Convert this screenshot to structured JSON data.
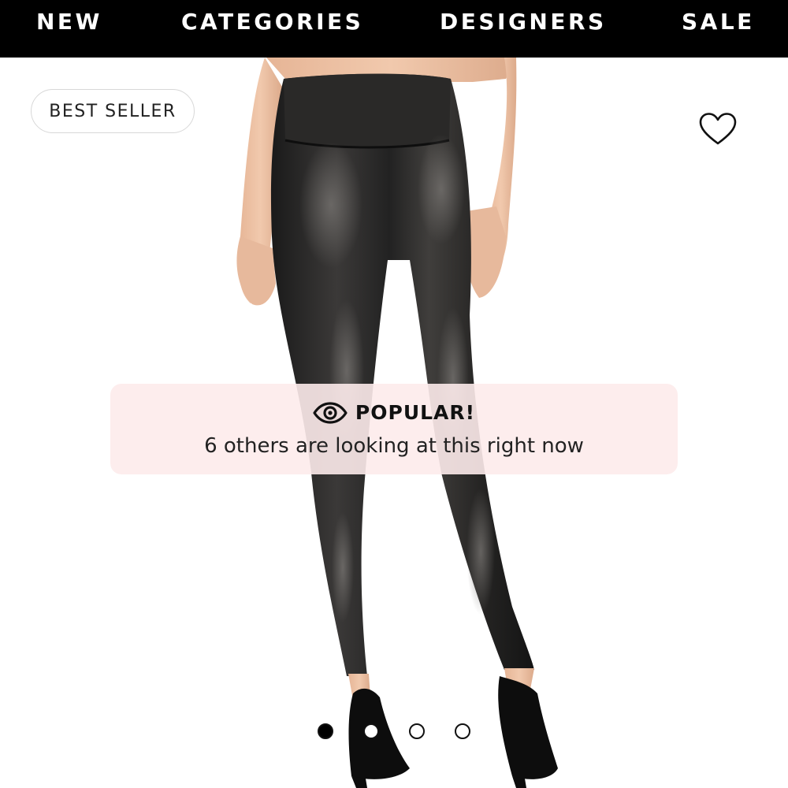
{
  "nav": {
    "items": [
      {
        "label": "NEW"
      },
      {
        "label": "CATEGORIES"
      },
      {
        "label": "DESIGNERS"
      },
      {
        "label": "SALE"
      }
    ]
  },
  "product": {
    "badge": "BEST SELLER",
    "favorite_icon": "heart-outline-icon",
    "image_subject": "black faux-leather high-waisted leggings worn with black pumps"
  },
  "popular": {
    "icon": "eye-icon",
    "title": "POPULAR!",
    "subtitle": "6 others are looking at this right now",
    "background": "#fdebeb"
  },
  "carousel": {
    "total": 4,
    "active_index": 0
  },
  "colors": {
    "nav_bg": "#000000",
    "nav_text": "#ffffff",
    "banner_bg": "#fdebeb"
  }
}
